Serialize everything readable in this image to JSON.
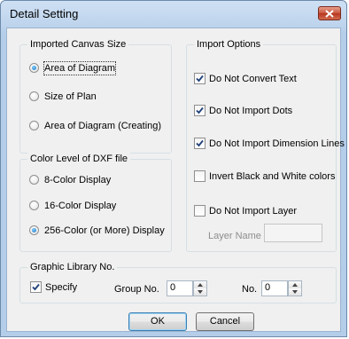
{
  "window": {
    "title": "Detail Setting"
  },
  "canvas_size": {
    "title": "Imported Canvas Size",
    "options": [
      "Area of Diagram",
      "Size of Plan",
      "Area of Diagram (Creating)"
    ],
    "selected": 0
  },
  "color_level": {
    "title": "Color Level of DXF file",
    "options": [
      "8-Color Display",
      "16-Color Display",
      "256-Color (or More) Display"
    ],
    "selected": 2
  },
  "import_options": {
    "title": "Import Options",
    "items": [
      {
        "label": "Do Not Convert Text",
        "checked": true
      },
      {
        "label": "Do Not Import Dots",
        "checked": true
      },
      {
        "label": "Do Not Import Dimension Lines",
        "checked": true
      },
      {
        "label": "Invert Black and White colors",
        "checked": false
      },
      {
        "label": "Do Not Import Layer",
        "checked": false
      }
    ],
    "layer_name_label": "Layer Name",
    "layer_name_value": ""
  },
  "graphic_library": {
    "title": "Graphic Library No.",
    "specify_label": "Specify",
    "specify_checked": true,
    "group_no_label": "Group No.",
    "group_no_value": "0",
    "no_label": "No.",
    "no_value": "0"
  },
  "buttons": {
    "ok": "OK",
    "cancel": "Cancel"
  },
  "icons": {
    "close": "close-icon",
    "spin_up": "spin-up-icon",
    "spin_down": "spin-down-icon",
    "check": "checkmark-icon"
  },
  "colors": {
    "accent": "#1b6fbf",
    "close": "#c7543a",
    "titlebar": "#bcd3ec"
  }
}
